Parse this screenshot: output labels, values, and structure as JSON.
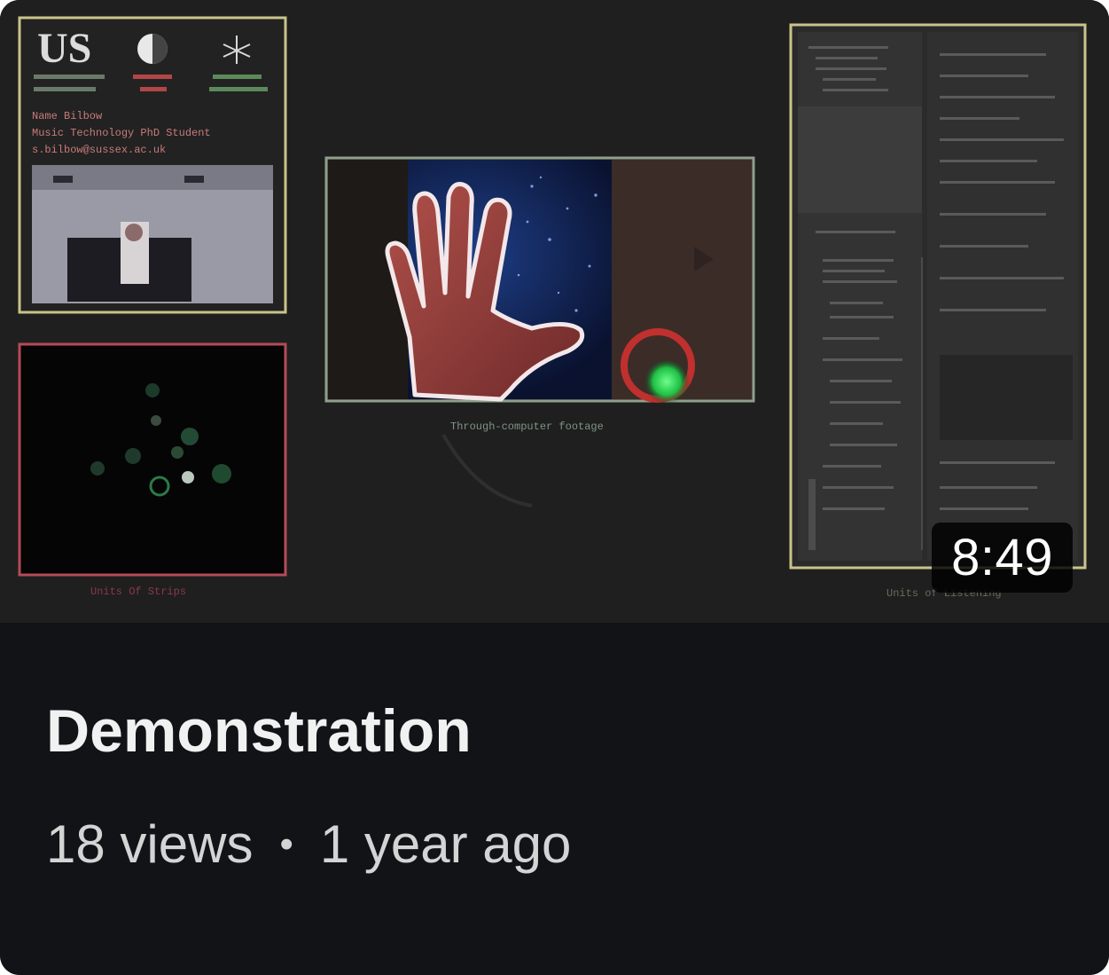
{
  "video": {
    "title": "Demonstration",
    "duration": "8:49",
    "views": "18 views",
    "separator": "•",
    "age": "1 year ago"
  },
  "thumbnail": {
    "logo_text": "US",
    "presenter_lines": [
      "Name Bilbow",
      "Music Technology PhD Student",
      "s.bilbow@sussex.ac.uk"
    ],
    "center_caption": "Through-computer footage",
    "left_caption": "Units Of Strips",
    "right_caption": "Units of Listening"
  },
  "colors": {
    "card_background": "#111317",
    "thumbnail_background": "#1f1f1f",
    "title_text": "#f1f1f1",
    "meta_text": "#d4d4d4",
    "duration_badge": "#000000"
  },
  "icons": {
    "duration_badge": "duration-badge"
  }
}
